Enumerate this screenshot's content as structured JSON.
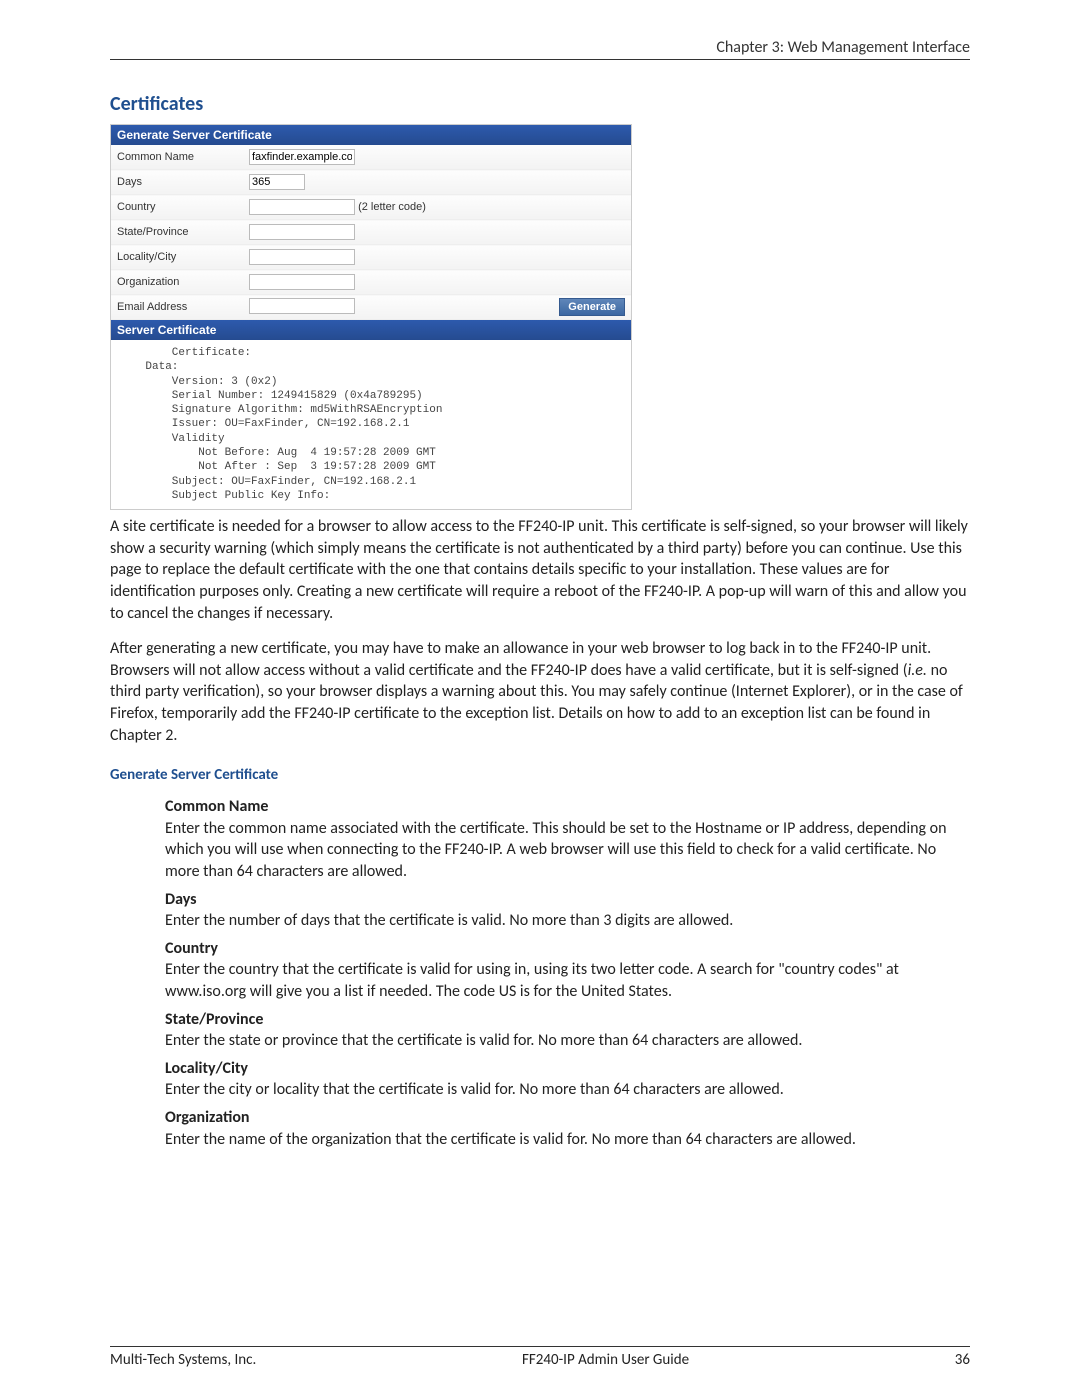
{
  "header": {
    "chapter": "Chapter 3: Web Management Interface"
  },
  "section_title": "Certificates",
  "screenshot": {
    "panel1_title": "Generate Server Certificate",
    "fields": {
      "common_name": {
        "label": "Common Name",
        "value": "faxfinder.example.com"
      },
      "days": {
        "label": "Days",
        "value": "365"
      },
      "country": {
        "label": "Country",
        "value": "",
        "hint": "(2 letter code)"
      },
      "state": {
        "label": "State/Province",
        "value": ""
      },
      "locality": {
        "label": "Locality/City",
        "value": ""
      },
      "organization": {
        "label": "Organization",
        "value": ""
      },
      "email": {
        "label": "Email Address",
        "value": ""
      }
    },
    "generate_label": "Generate",
    "panel2_title": "Server Certificate",
    "cert_text": "        Certificate:\n    Data:\n        Version: 3 (0x2)\n        Serial Number: 1249415829 (0x4a789295)\n        Signature Algorithm: md5WithRSAEncryption\n        Issuer: OU=FaxFinder, CN=192.168.2.1\n        Validity\n            Not Before: Aug  4 19:57:28 2009 GMT\n            Not After : Sep  3 19:57:28 2009 GMT\n        Subject: OU=FaxFinder, CN=192.168.2.1\n        Subject Public Key Info:"
  },
  "para1": "A site certificate is needed for a browser to allow access to the FF240-IP unit. This certificate is self-signed, so your browser will likely show a security warning (which simply means the certificate is not authenticated by a third party) before you can continue. Use this page to replace the default certificate with the one that contains details specific to your installation. These values are for identification purposes only. Creating a new certificate will require a reboot of the FF240-IP. A pop-up will warn of this and allow you to cancel the changes if necessary.",
  "para2a": "After generating a new certificate, you may have to make an allowance in your web browser to log back in to the FF240-IP unit. Browsers will not allow access without a valid certificate and the FF240-IP does have a valid certificate, but it is self-signed (",
  "para2_ital": "i.e.",
  "para2b": " no third party verification), so your browser displays a warning about this. You may safely continue (Internet Explorer), or in the case of Firefox, temporarily add the FF240-IP certificate to the exception list. Details on how to add to an exception list can be found in Chapter 2.",
  "subhead1": "Generate Server Certificate",
  "defs": {
    "common_name": {
      "t": "Common Name",
      "d": "Enter the common name associated with the certificate. This should be set to the Hostname or IP address, depending on which you will use when connecting to the FF240-IP. A web browser will use this field to check for a valid certificate. No more than 64 characters are allowed."
    },
    "days": {
      "t": "Days",
      "d": "Enter the number of days that the certificate is valid. No more than 3 digits are allowed."
    },
    "country": {
      "t": "Country",
      "d": "Enter the country that the certificate is valid for using in, using its two letter code. A search for \"country codes\" at www.iso.org will give you a list if needed. The code US is for the United States."
    },
    "state": {
      "t": "State/Province",
      "d": "Enter the state or province that the certificate is valid for. No more than 64 characters are allowed."
    },
    "locality": {
      "t": "Locality/City",
      "d": "Enter the city or locality that the certificate is valid for. No more than 64 characters are allowed."
    },
    "organization": {
      "t": "Organization",
      "d": "Enter the name of the organization that the certificate is valid for. No more than 64 characters are allowed."
    }
  },
  "footer": {
    "left": "Multi-Tech Systems, Inc.",
    "center": "FF240-IP Admin User Guide",
    "right": "36"
  }
}
